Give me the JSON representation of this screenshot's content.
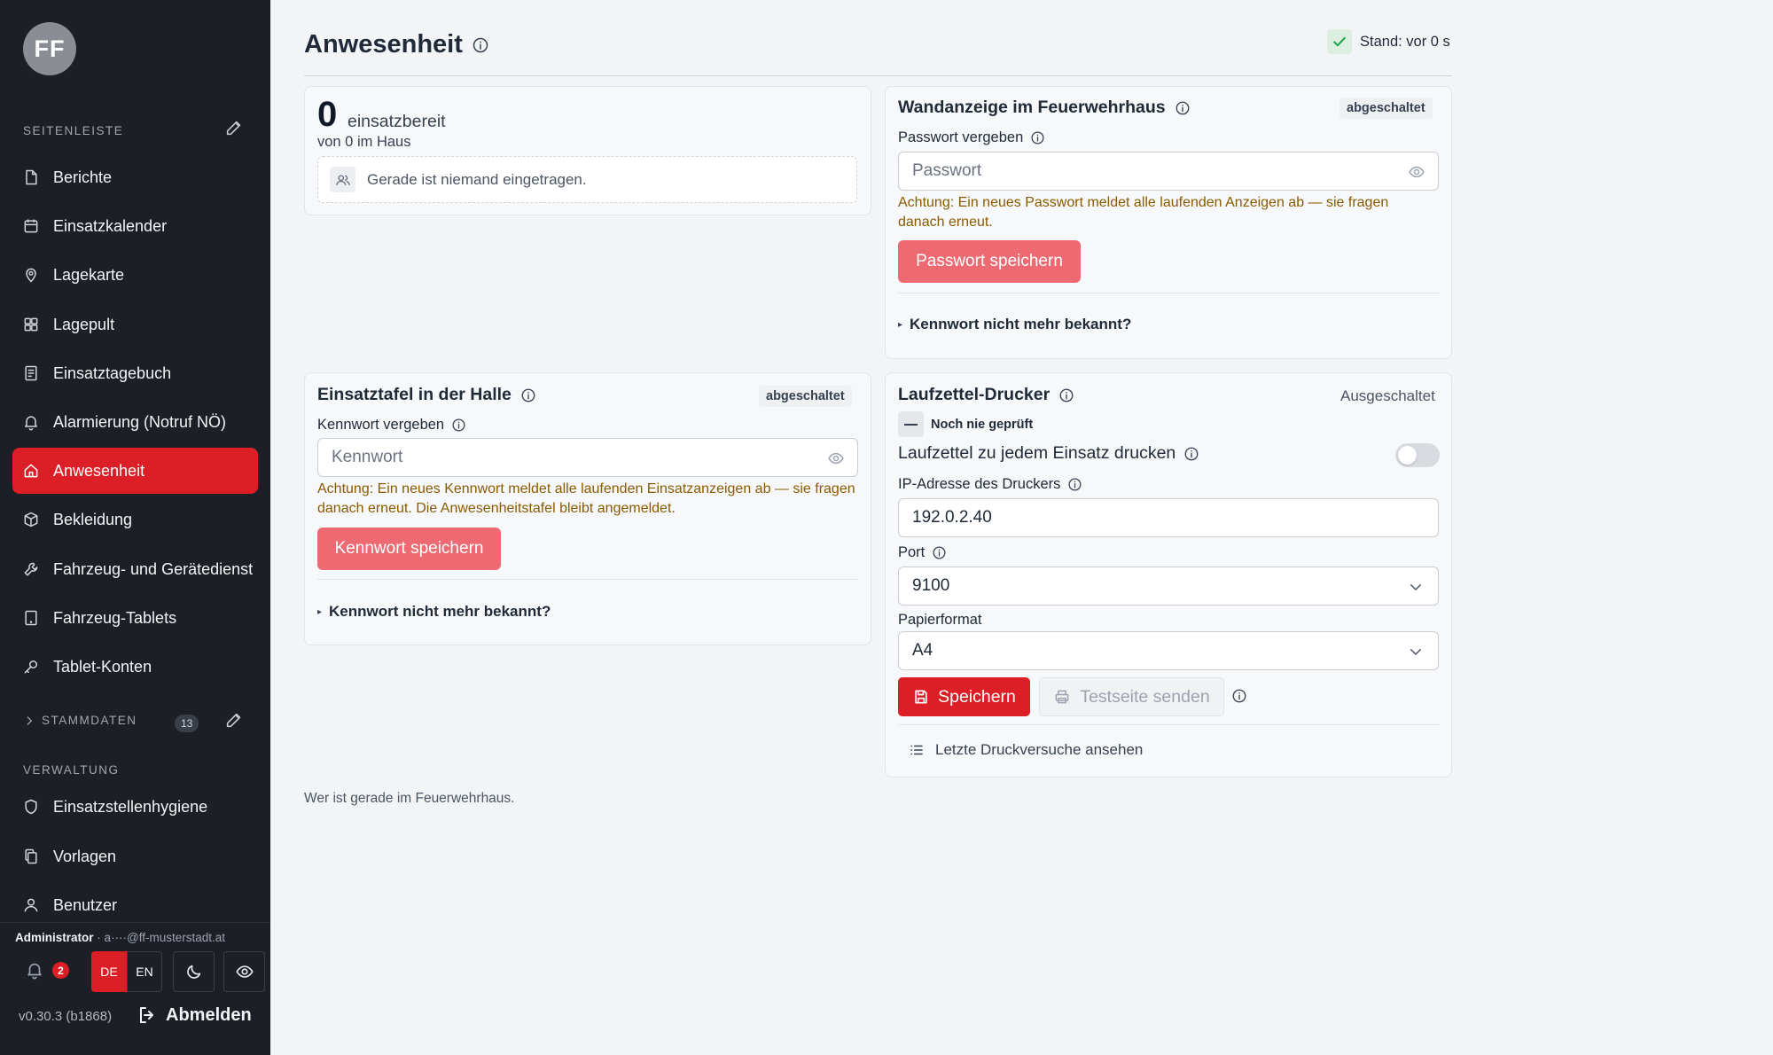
{
  "sidebar": {
    "avatar_initials": "FF",
    "section_sidebar": "SEITENLEISTE",
    "items": [
      {
        "label": "Berichte",
        "icon": "document-icon"
      },
      {
        "label": "Einsatzkalender",
        "icon": "calendar-icon"
      },
      {
        "label": "Lagekarte",
        "icon": "map-pin-icon"
      },
      {
        "label": "Lagepult",
        "icon": "grid-icon"
      },
      {
        "label": "Einsatztagebuch",
        "icon": "journal-icon"
      },
      {
        "label": "Alarmierung (Notruf NÖ)",
        "icon": "bell-icon"
      },
      {
        "label": "Anwesenheit",
        "icon": "home-icon",
        "active": true
      },
      {
        "label": "Bekleidung",
        "icon": "box-icon"
      },
      {
        "label": "Fahrzeug- und Gerätedienst",
        "icon": "wrench-icon"
      },
      {
        "label": "Fahrzeug-Tablets",
        "icon": "tablet-icon"
      },
      {
        "label": "Tablet-Konten",
        "icon": "key-icon"
      }
    ],
    "section_stammdaten": "STAMMDATEN",
    "stammdaten_count": "13",
    "section_verwaltung": "VERWALTUNG",
    "admin_items": [
      {
        "label": "Einsatzstellenhygiene",
        "icon": "shield-icon"
      },
      {
        "label": "Vorlagen",
        "icon": "copy-icon"
      },
      {
        "label": "Benutzer",
        "icon": "user-icon"
      }
    ],
    "user_role": "Administrator",
    "user_email": "a····@ff-musterstadt.at",
    "notification_count": "2",
    "lang_de": "DE",
    "lang_en": "EN",
    "version": "v0.30.3 (b1868)",
    "logout_label": "Abmelden"
  },
  "header": {
    "title": "Anwesenheit",
    "status": "Stand: vor 0 s"
  },
  "presence": {
    "count": "0",
    "count_label": "einsatzbereit",
    "sub": "von 0 im Haus",
    "empty": "Gerade ist niemand eingetragen."
  },
  "wall_display": {
    "title": "Wandanzeige im Feuerwehrhaus",
    "badge": "abgeschaltet",
    "field_label": "Passwort vergeben",
    "placeholder": "Passwort",
    "warning": "Achtung: Ein neues Passwort meldet alle laufenden Anzeigen ab — sie fragen danach erneut.",
    "save_label": "Passwort speichern",
    "forgot": "Kennwort nicht mehr bekannt?"
  },
  "hall_board": {
    "title": "Einsatztafel in der Halle",
    "badge": "abgeschaltet",
    "field_label": "Kennwort vergeben",
    "placeholder": "Kennwort",
    "warning": "Achtung: Ein neues Kennwort meldet alle laufenden Einsatzanzeigen ab — sie fragen danach erneut. Die Anwesenheitstafel bleibt angemeldet.",
    "save_label": "Kennwort speichern",
    "forgot": "Kennwort nicht mehr bekannt?"
  },
  "printer": {
    "title": "Laufzettel-Drucker",
    "state": "Ausgeschaltet",
    "check_status": "Noch nie geprüft",
    "toggle_label": "Laufzettel zu jedem Einsatz drucken",
    "toggle_on": false,
    "ip_label": "IP-Adresse des Druckers",
    "ip_value": "192.0.2.40",
    "port_label": "Port",
    "port_value": "9100",
    "paper_label": "Papierformat",
    "paper_value": "A4",
    "save_label": "Speichern",
    "test_label": "Testseite senden",
    "history_label": "Letzte Druckversuche ansehen"
  },
  "footer_note": "Wer ist gerade im Feuerwehrhaus."
}
